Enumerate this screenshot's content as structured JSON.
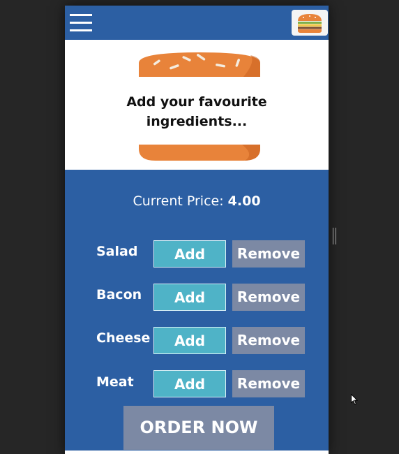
{
  "header": {
    "menu_icon": "hamburger-menu-icon",
    "burger_icon": "burger-icon"
  },
  "hero": {
    "text": "Add your favourite\ningredients..."
  },
  "price": {
    "label": "Current Price:",
    "value": "4.00"
  },
  "ingredients": [
    {
      "name": "Salad",
      "add_label": "Add",
      "remove_label": "Remove"
    },
    {
      "name": "Bacon",
      "add_label": "Add",
      "remove_label": "Remove"
    },
    {
      "name": "Cheese",
      "add_label": "Add",
      "remove_label": "Remove"
    },
    {
      "name": "Meat",
      "add_label": "Add",
      "remove_label": "Remove"
    }
  ],
  "order_button": "ORDER NOW",
  "colors": {
    "primary": "#2c5fa3",
    "add": "#4fb3c7",
    "remove": "#7c89a4",
    "bun": "#e8833a",
    "background": "#262626"
  }
}
